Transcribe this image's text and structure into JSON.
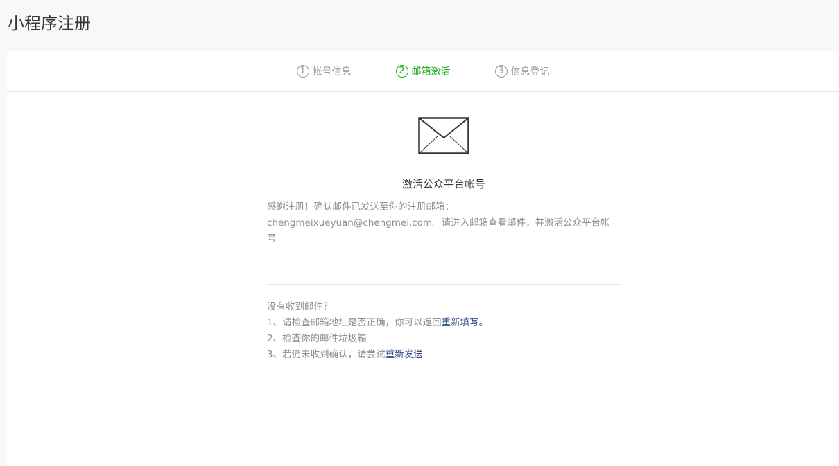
{
  "page_title": "小程序注册",
  "steps": [
    {
      "num": "1",
      "label": "帐号信息"
    },
    {
      "num": "2",
      "label": "邮箱激活"
    },
    {
      "num": "3",
      "label": "信息登记"
    }
  ],
  "main": {
    "heading": "激活公众平台帐号",
    "desc_line1": "感谢注册！确认邮件已发送至你的注册邮箱：",
    "desc_line2": "chengmeixueyuan@chengmei.com。请进入邮箱查看邮件，并激活公众平台帐号。"
  },
  "help": {
    "title": "没有收到邮件？",
    "item1_text": "1、请检查邮箱地址是否正确，你可以返回",
    "item1_link": "重新填写。",
    "item2_text": "2、检查你的邮件垃圾箱",
    "item3_text": "3、若仍未收到确认，请尝试",
    "item3_link": "重新发送"
  },
  "colors": {
    "active": "#1aad19",
    "link": "#2d4a80"
  }
}
